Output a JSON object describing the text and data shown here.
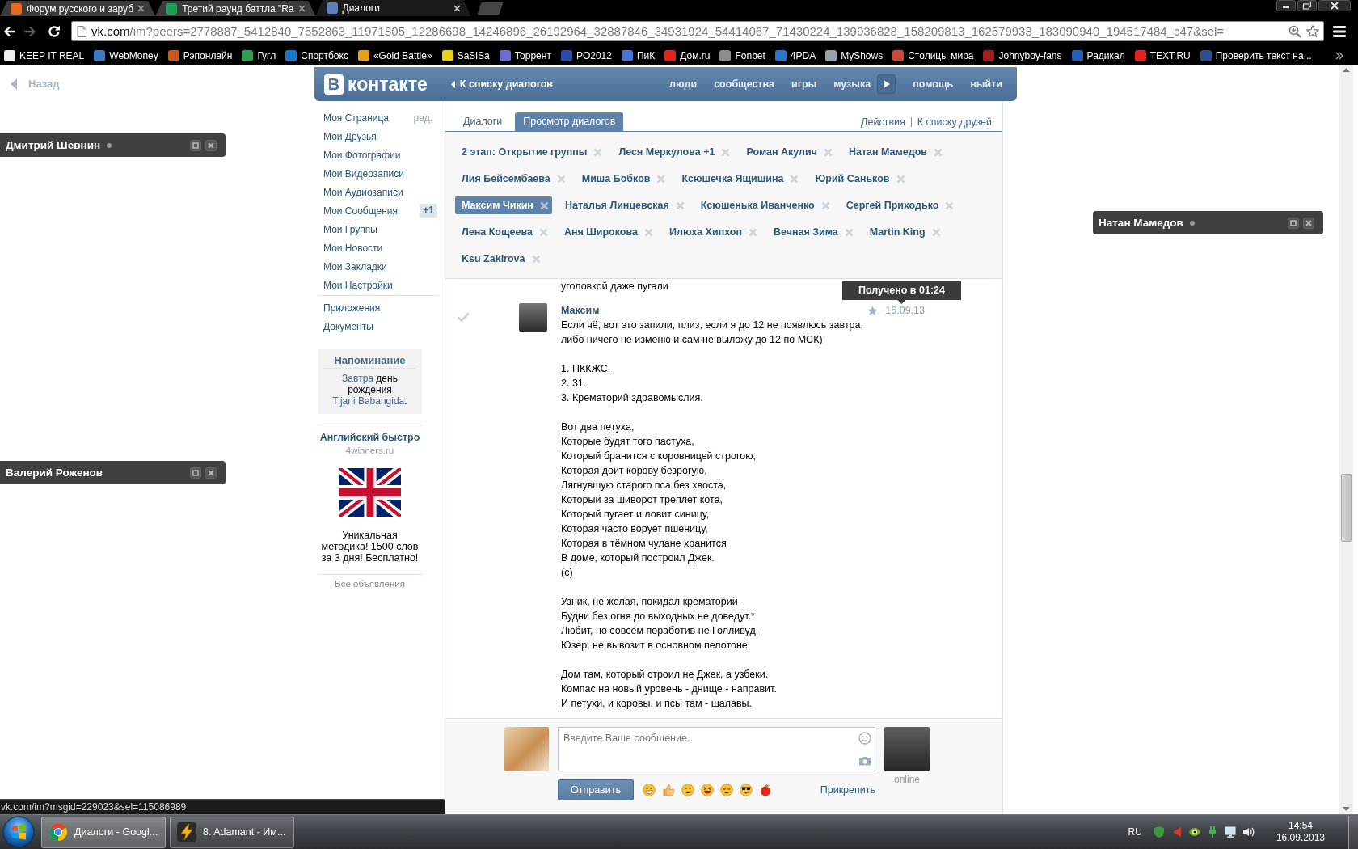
{
  "browser": {
    "tabs": [
      {
        "title": "Форум русского и заруб",
        "color": "#e46a1c",
        "selected": false
      },
      {
        "title": "Третий раунд баттла \"Ra",
        "color": "#1e9e52",
        "selected": false
      },
      {
        "title": "Диалоги",
        "color": "#5d80b8",
        "selected": true
      }
    ],
    "forward_disabled": true,
    "address": {
      "host": "vk.com",
      "path": "/im?peers=2778887_5412840_7552863_11971805_12286698_14246896_26192964_32887846_34931924_54414067_71430224_139936828_158209813_162579933_183090940_194517484_c47&sel="
    },
    "bookmarks": [
      {
        "label": "KEEP IT REAL",
        "color": "#f0f0f0"
      },
      {
        "label": "WebMoney",
        "color": "#3b7cc4"
      },
      {
        "label": "Рэпонлайн",
        "color": "#c45a1c"
      },
      {
        "label": "Гугл",
        "color": "#2f9e4f"
      },
      {
        "label": "Спортбокс",
        "color": "#1a78cc"
      },
      {
        "label": "«Gold Battle»",
        "color": "#e3a21a"
      },
      {
        "label": "SaSiSa",
        "color": "#e8d21c"
      },
      {
        "label": "Торрент",
        "color": "#6b6fd0"
      },
      {
        "label": "PO2012",
        "color": "#2a4ea6"
      },
      {
        "label": "ПиК",
        "color": "#4a72d0"
      },
      {
        "label": "Дом.ru",
        "color": "#e0241c"
      },
      {
        "label": "Fonbet",
        "color": "#8c8c8c"
      },
      {
        "label": "4PDA",
        "color": "#2e74c8"
      },
      {
        "label": "MyShows",
        "color": "#97a1ac"
      },
      {
        "label": "Столицы мира",
        "color": "#c8483a"
      },
      {
        "label": "Johnyboy-fans",
        "color": "#a21f1f"
      },
      {
        "label": "Радикал",
        "color": "#2a5eb2"
      },
      {
        "label": "TEXT.RU",
        "color": "#e2231f"
      },
      {
        "label": "Проверить текст на...",
        "color": "#2b4f8e"
      }
    ]
  },
  "page": {
    "back_link": "Назад",
    "header": {
      "logo_mark": "В",
      "logo_text": "контакте",
      "back_link": "К списку диалогов",
      "nav": [
        {
          "kind": "link",
          "label": "люди"
        },
        {
          "kind": "link",
          "label": "сообщества"
        },
        {
          "kind": "link",
          "label": "игры"
        },
        {
          "kind": "link",
          "label": "музыка"
        },
        {
          "kind": "play"
        },
        {
          "kind": "link",
          "label": "помощь"
        },
        {
          "kind": "link",
          "label": "выйти"
        }
      ]
    },
    "sidebar": {
      "menu": [
        {
          "label": "Моя Страница",
          "edit": "ред."
        },
        {
          "label": "Мои Друзья"
        },
        {
          "label": "Мои Фотографии"
        },
        {
          "label": "Мои Видеозаписи"
        },
        {
          "label": "Мои Аудиозаписи"
        },
        {
          "label": "Мои Сообщения",
          "badge": "+1"
        },
        {
          "label": "Мои Группы"
        },
        {
          "label": "Мои Новости"
        },
        {
          "label": "Мои Закладки"
        },
        {
          "label": "Мои Настройки"
        }
      ],
      "extra_menu": [
        {
          "label": "Приложения"
        },
        {
          "label": "Документы"
        }
      ],
      "reminder": {
        "title": "Напоминание",
        "text": [
          {
            "text": "Завтра",
            "link": true
          },
          {
            "text": " день рождения ",
            "link": false
          },
          {
            "text": "Tijani Babangida",
            "link": true
          },
          {
            "text": ".",
            "link": false
          }
        ]
      },
      "ad": {
        "title": "Английский быстро",
        "domain": "4winners.ru",
        "text": "Уникальная методика! 1500 слов за 3 дня! Бесплатно!",
        "all_ads": "Все объявления"
      }
    },
    "dialogs": {
      "tabs": [
        {
          "label": "Диалоги",
          "selected": false
        },
        {
          "label": "Просмотр диалогов",
          "selected": true
        }
      ],
      "actions": [
        "Действия",
        "К списку друзей"
      ],
      "chats": [
        {
          "label": "2 этап: Открытие группы",
          "selected": false
        },
        {
          "label": "Леся Меркулова +1",
          "selected": false
        },
        {
          "label": "Роман Акулич",
          "selected": false
        },
        {
          "label": "Натан Мамедов",
          "selected": false
        },
        {
          "label": "Лия Бейсембаева",
          "selected": false
        },
        {
          "label": "Миша Бобков",
          "selected": false
        },
        {
          "label": "Ксюшечка Ящишина",
          "selected": false
        },
        {
          "label": "Юрий Саньков",
          "selected": false
        },
        {
          "label": "Максим Чикин",
          "selected": true
        },
        {
          "label": "Наталья Линцевская",
          "selected": false
        },
        {
          "label": "Ксюшенька Иванченко",
          "selected": false
        },
        {
          "label": "Сергей Приходько",
          "selected": false
        },
        {
          "label": "Лена Кощеева",
          "selected": false
        },
        {
          "label": "Аня Широкова",
          "selected": false
        },
        {
          "label": "Илюха Хипхоп",
          "selected": false
        },
        {
          "label": "Вечная Зима",
          "selected": false
        },
        {
          "label": "Martin King",
          "selected": false
        },
        {
          "label": "Ksu Zakirova",
          "selected": false
        }
      ],
      "history": [
        {
          "kind": "fragment",
          "text": "уголовкой даже пугали"
        },
        {
          "kind": "message",
          "author": "Максим",
          "date": "16.09.13",
          "tooltip": "Получено в 01:24",
          "paragraphs": [
            "Если чё, вот это запили, плиз, если я до 12 не появлюсь завтра,\nлибо ничего не изменю и сам не выложу до 12 по МСК)",
            "1. ПККЖС.\n2. 31.\n3. Крематорий здравомыслия.",
            "Вот два петуха,\nКоторые будят того пастуха,\nКоторый бранится с коровницей строгою,\nКоторая доит корову безрогую,\nЛягнувшую старого пса без хвоста,\nКоторый за шиворот треплет кота,\nКоторый пугает и ловит синицу,\nКоторая часто ворует пшеницу,\nКоторая в тёмном чулане хранится\nВ доме, который построил Джек.\n(c)",
            "Узник, не желая, покидал крематорий -\nБудни без огня до выходных не доведут.*\nЛюбит, но совсем поработив не Голливуд,\nЮзер, не вывозит в основном пелотоне.",
            "Дом там, который строил не Джек, а узбеки.\nКомпас на новый уровень - днище - направит.\nИ петухи, и коровы, и псы там - шалавы."
          ]
        }
      ],
      "composer": {
        "placeholder": "Введите Ваше сообщение..",
        "send": "Отправить",
        "attach": "Прикрепить",
        "status": "online"
      }
    }
  },
  "chat_windows": [
    {
      "name": "Дмитрий Шевнин",
      "status_dot": true
    },
    {
      "name": "Валерий Роженов",
      "status_dot": false
    },
    {
      "name": "Натан Мамедов",
      "status_dot": true
    }
  ],
  "status_url": "vk.com/im?msgid=229023&sel=115086989",
  "taskbar": {
    "windows": [
      {
        "title": "Диалоги - Googl...",
        "selected": true
      },
      {
        "title": "8. Adamant - Им...",
        "selected": false
      }
    ],
    "language": "RU",
    "time": "14:54",
    "date": "16.09.2013"
  }
}
